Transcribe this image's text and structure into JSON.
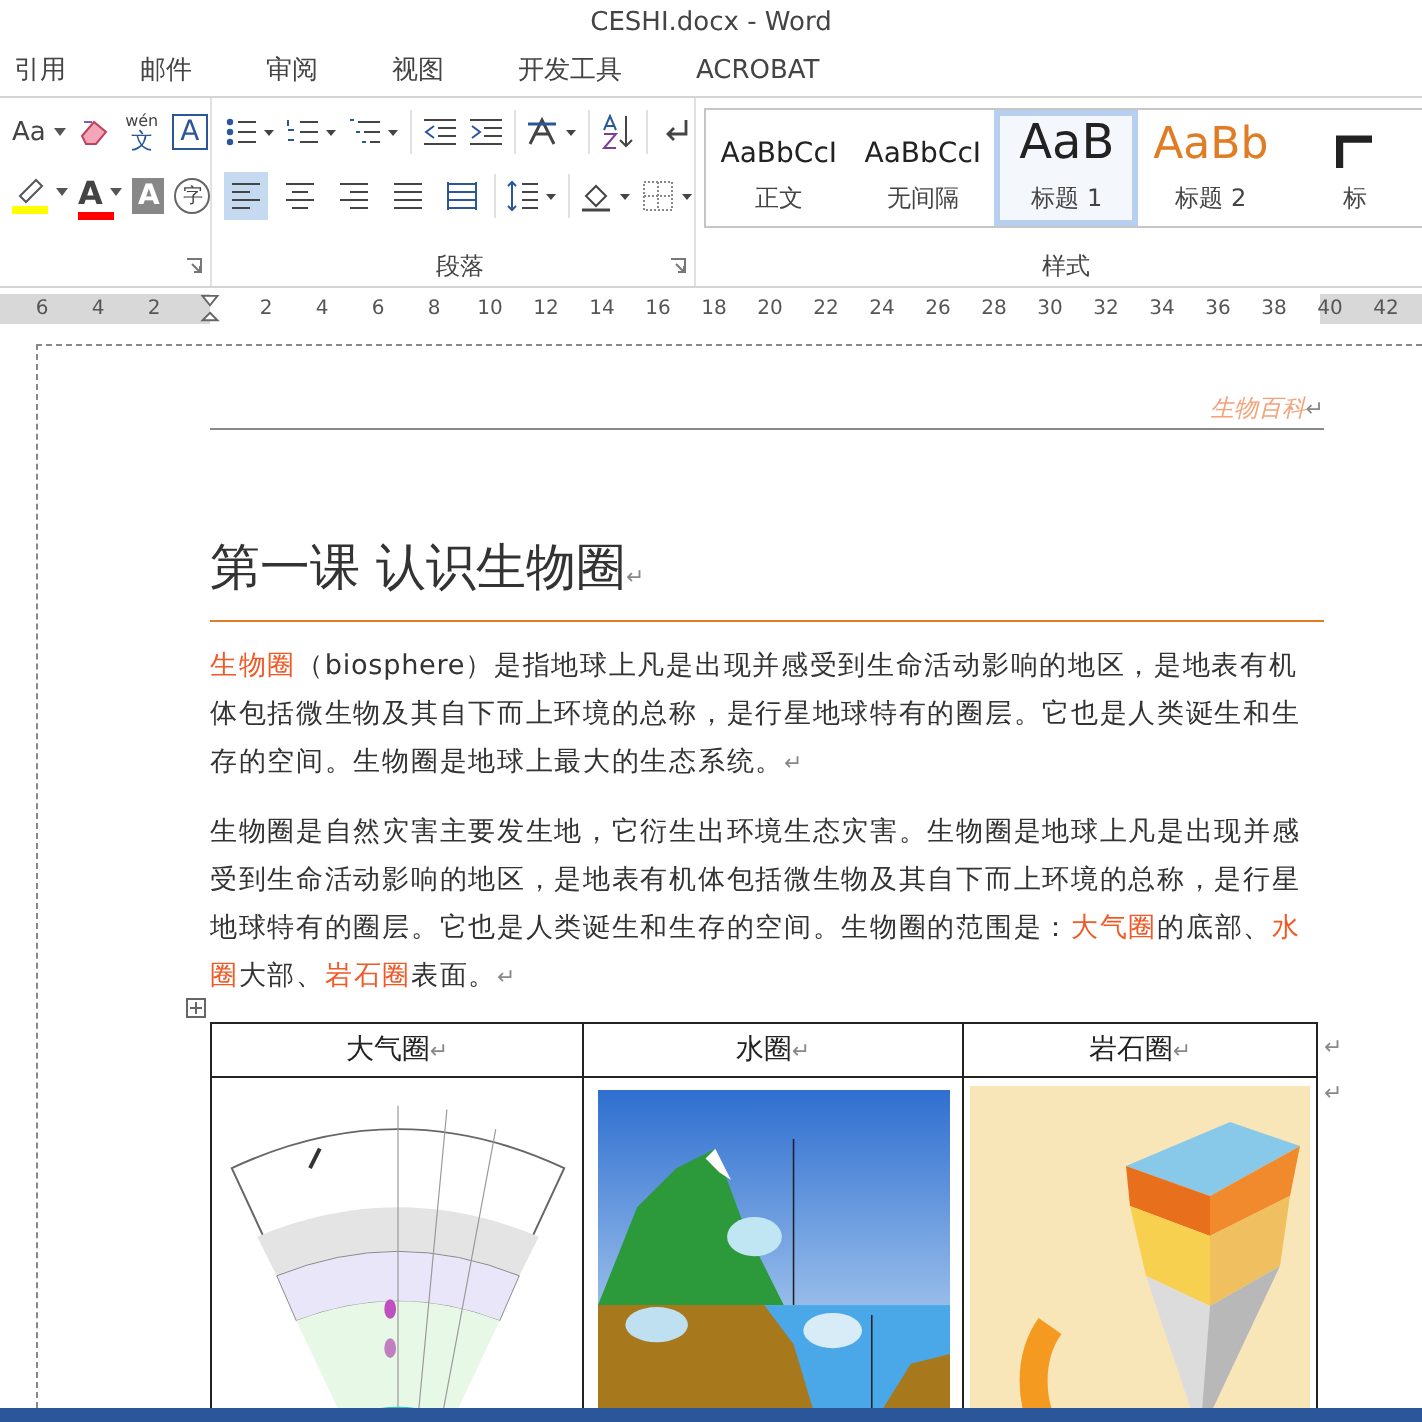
{
  "window": {
    "title": "CESHI.docx - Word"
  },
  "tabs": [
    {
      "label": "引用",
      "selected": false
    },
    {
      "label": "邮件",
      "selected": false
    },
    {
      "label": "审阅",
      "selected": false
    },
    {
      "label": "视图",
      "selected": false
    },
    {
      "label": "开发工具",
      "selected": false
    },
    {
      "label": "ACROBAT",
      "selected": false
    }
  ],
  "font_group": {
    "rows": [
      [
        {
          "kind": "font-size",
          "label": "Aa"
        },
        {
          "kind": "eraser"
        },
        {
          "kind": "phonetic",
          "label": "wén",
          "sub": "文"
        },
        {
          "kind": "boxed",
          "label": "A"
        }
      ],
      [
        {
          "kind": "highlighter",
          "color": "#ffff00"
        },
        {
          "kind": "font-color",
          "label": "A",
          "color": "#ff0000"
        },
        {
          "kind": "shaded",
          "label": "A"
        },
        {
          "kind": "enclosed",
          "label": "字"
        }
      ]
    ]
  },
  "paragraph_group": {
    "label": "段落",
    "row1": [
      {
        "kind": "bullets"
      },
      {
        "kind": "numbering"
      },
      {
        "kind": "multilevel"
      },
      {
        "kind": "sep"
      },
      {
        "kind": "decrease-indent"
      },
      {
        "kind": "increase-indent"
      },
      {
        "kind": "sep"
      },
      {
        "kind": "asian-layout"
      },
      {
        "kind": "sep"
      },
      {
        "kind": "sort"
      },
      {
        "kind": "sep"
      },
      {
        "kind": "show-marks"
      }
    ],
    "alignment": [
      {
        "kind": "left",
        "selected": true
      },
      {
        "kind": "center",
        "selected": false
      },
      {
        "kind": "right",
        "selected": false
      },
      {
        "kind": "justify",
        "selected": false
      },
      {
        "kind": "distributed",
        "selected": false
      }
    ],
    "row2": [
      {
        "kind": "sep"
      },
      {
        "kind": "line-spacing"
      },
      {
        "kind": "sep"
      },
      {
        "kind": "shading"
      },
      {
        "kind": "borders"
      }
    ]
  },
  "styles_group": {
    "label": "样式",
    "styles": [
      {
        "preview": "AaBbCcI",
        "label": "正文",
        "kind": "normal",
        "selected": false
      },
      {
        "preview": "AaBbCcI",
        "label": "无间隔",
        "kind": "normal",
        "selected": false
      },
      {
        "preview": "AaB",
        "label": "标题 1",
        "kind": "heading1",
        "selected": true
      },
      {
        "preview": "AaBb",
        "label": "标题 2",
        "kind": "heading2",
        "selected": false
      },
      {
        "label": "标",
        "kind": "title",
        "selected": false
      }
    ]
  },
  "ruler": {
    "left_ticks": [
      "6",
      "4",
      "2"
    ],
    "right_ticks": [
      "2",
      "4",
      "6",
      "8",
      "10",
      "12",
      "14",
      "16",
      "18",
      "20",
      "22",
      "24",
      "26",
      "28",
      "30",
      "32",
      "34",
      "36",
      "38",
      "40",
      "42"
    ]
  },
  "document": {
    "header": {
      "text": "生物百科",
      "end_mark": "↵"
    },
    "heading": {
      "text": "第一课  认识生物圈",
      "end_mark": "↵"
    },
    "paragraphs": [
      {
        "segments": [
          {
            "text": "生物圈",
            "highlight": true
          },
          {
            "text": "（biosphere）是指地球上凡是出现并感受到生命活动影响的地区，是地表有机体包括微生物及其自下而上环境的总称，是行星地球特有的圈层。它也是人类诞生和生存的空间。生物圈是地球上最大的生态系统。",
            "highlight": false
          }
        ],
        "end_mark": "↵"
      },
      {
        "segments": [
          {
            "text": "生物圈是自然灾害主要发生地，它衍生出环境生态灾害。生物圈是地球上凡是出现并感受到生命活动影响的地区，是地表有机体包括微生物及其自下而上环境的总称，是行星地球特有的圈层。它也是人类诞生和生存的空间。生物圈的范围是：",
            "highlight": false
          },
          {
            "text": "大气圈",
            "highlight": true
          },
          {
            "text": "的底部、",
            "highlight": false
          },
          {
            "text": "水圈",
            "highlight": true
          },
          {
            "text": "大部、",
            "highlight": false
          },
          {
            "text": "岩石圈",
            "highlight": true
          },
          {
            "text": "表面。",
            "highlight": false
          }
        ],
        "end_mark": "↵"
      }
    ],
    "table": {
      "columns": [
        {
          "header": "大气圈",
          "end_mark": "↵",
          "kind": "atmosphere"
        },
        {
          "header": "水圈",
          "end_mark": "↵",
          "kind": "ocean"
        },
        {
          "header": "岩石圈",
          "end_mark": "↵",
          "kind": "earth"
        }
      ],
      "row_marks": [
        "↵",
        "↵"
      ]
    }
  }
}
